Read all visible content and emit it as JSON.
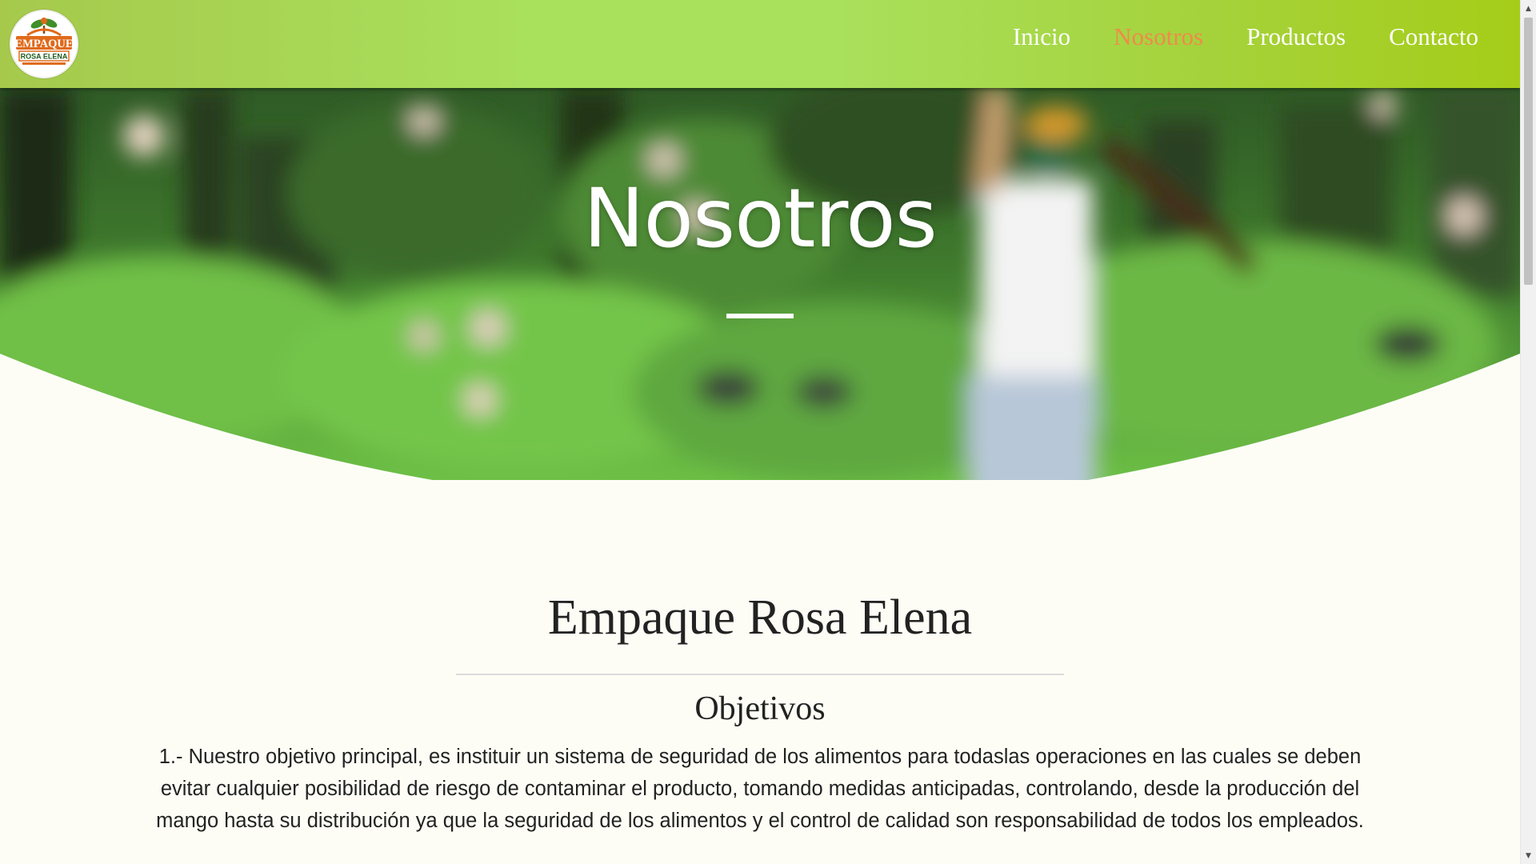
{
  "brand": {
    "logo_line1": "EMPAQUE",
    "logo_line2": "ROSA ELENA",
    "logo_icon": "mango-tree-icon"
  },
  "nav": {
    "items": [
      {
        "label": "Inicio",
        "active": false
      },
      {
        "label": "Nosotros",
        "active": true
      },
      {
        "label": "Productos",
        "active": false
      },
      {
        "label": "Contacto",
        "active": false
      }
    ]
  },
  "hero": {
    "title": "Nosotros"
  },
  "main": {
    "section_title": "Empaque Rosa Elena",
    "subsection_title": "Objetivos",
    "paragraph": "1.- Nuestro objetivo principal, es instituir un sistema de seguridad de los alimentos para todaslas operaciones en las cuales se deben evitar cualquier posibilidad de riesgo de contaminar el producto, tomando medidas anticipadas, controlando, desde la producción del mango hasta su distribución ya que la seguridad de los alimentos y el control de calidad son responsabilidad de todos los empleados."
  },
  "colors": {
    "nav_green": "#a9e05c",
    "nav_active": "#f08a4b",
    "logo_orange": "#e06a1b",
    "page_bg": "#fdfdf6",
    "text": "#222222"
  },
  "scrollbar": {
    "up_icon": "scroll-up-arrow-icon",
    "down_icon": "scroll-down-arrow-icon"
  }
}
